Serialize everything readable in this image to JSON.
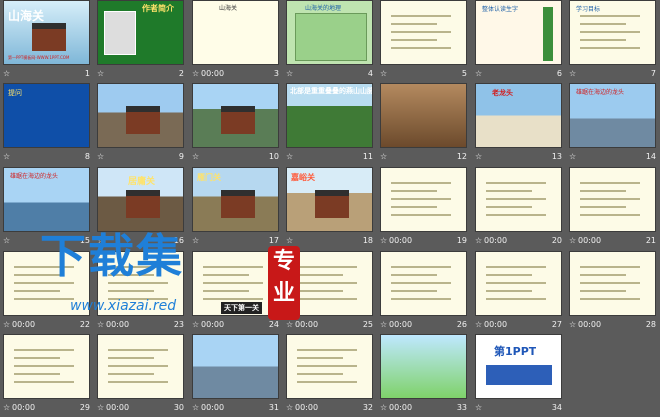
{
  "slides": [
    {
      "num": "1",
      "time": "",
      "title": "山海关",
      "sub": "第一PPT模板网-WWW.1PPT.COM"
    },
    {
      "num": "2",
      "time": "",
      "title": "作者简介"
    },
    {
      "num": "3",
      "time": "00:00",
      "title": "山海关"
    },
    {
      "num": "4",
      "time": "",
      "title": "山海关的地理"
    },
    {
      "num": "5",
      "time": "",
      "title": ""
    },
    {
      "num": "6",
      "time": "",
      "title": "整体认读生字"
    },
    {
      "num": "7",
      "time": "",
      "title": "学习目标"
    },
    {
      "num": "8",
      "time": "",
      "title": "提问"
    },
    {
      "num": "9",
      "time": "",
      "title": ""
    },
    {
      "num": "10",
      "time": "",
      "title": ""
    },
    {
      "num": "11",
      "time": "",
      "title": "北部是重重叠叠的燕山山脉"
    },
    {
      "num": "12",
      "time": "",
      "title": ""
    },
    {
      "num": "13",
      "time": "",
      "title": "老龙头"
    },
    {
      "num": "14",
      "time": "",
      "title": "雄踞在海边的龙头"
    },
    {
      "num": "15",
      "time": "",
      "title": "雄踞在海边的龙头"
    },
    {
      "num": "16",
      "time": "",
      "title": "居庸关"
    },
    {
      "num": "17",
      "time": "",
      "title": "雁门关"
    },
    {
      "num": "18",
      "time": "",
      "title": "嘉峪关"
    },
    {
      "num": "19",
      "time": "00:00",
      "title": ""
    },
    {
      "num": "20",
      "time": "00:00",
      "title": ""
    },
    {
      "num": "21",
      "time": "00:00",
      "title": ""
    },
    {
      "num": "22",
      "time": "00:00",
      "title": ""
    },
    {
      "num": "23",
      "time": "00:00",
      "title": ""
    },
    {
      "num": "24",
      "time": "00:00",
      "title": "天下第一关"
    },
    {
      "num": "25",
      "time": "00:00",
      "title": ""
    },
    {
      "num": "26",
      "time": "00:00",
      "title": ""
    },
    {
      "num": "27",
      "time": "00:00",
      "title": ""
    },
    {
      "num": "28",
      "time": "00:00",
      "title": ""
    },
    {
      "num": "29",
      "time": "00:00",
      "title": ""
    },
    {
      "num": "30",
      "time": "00:00",
      "title": ""
    },
    {
      "num": "31",
      "time": "00:00",
      "title": ""
    },
    {
      "num": "32",
      "time": "00:00",
      "title": ""
    },
    {
      "num": "33",
      "time": "00:00",
      "title": ""
    },
    {
      "num": "34",
      "time": "",
      "title": "第1PPT"
    }
  ],
  "watermark": {
    "cn": "下载集",
    "badge": "专业",
    "url": "www.xiazai.red"
  },
  "colors": {
    "background": "#5b5b5b",
    "footer_text": "#f1f1f1",
    "watermark_blue": "#1f7fd8",
    "watermark_red": "#c81818"
  }
}
